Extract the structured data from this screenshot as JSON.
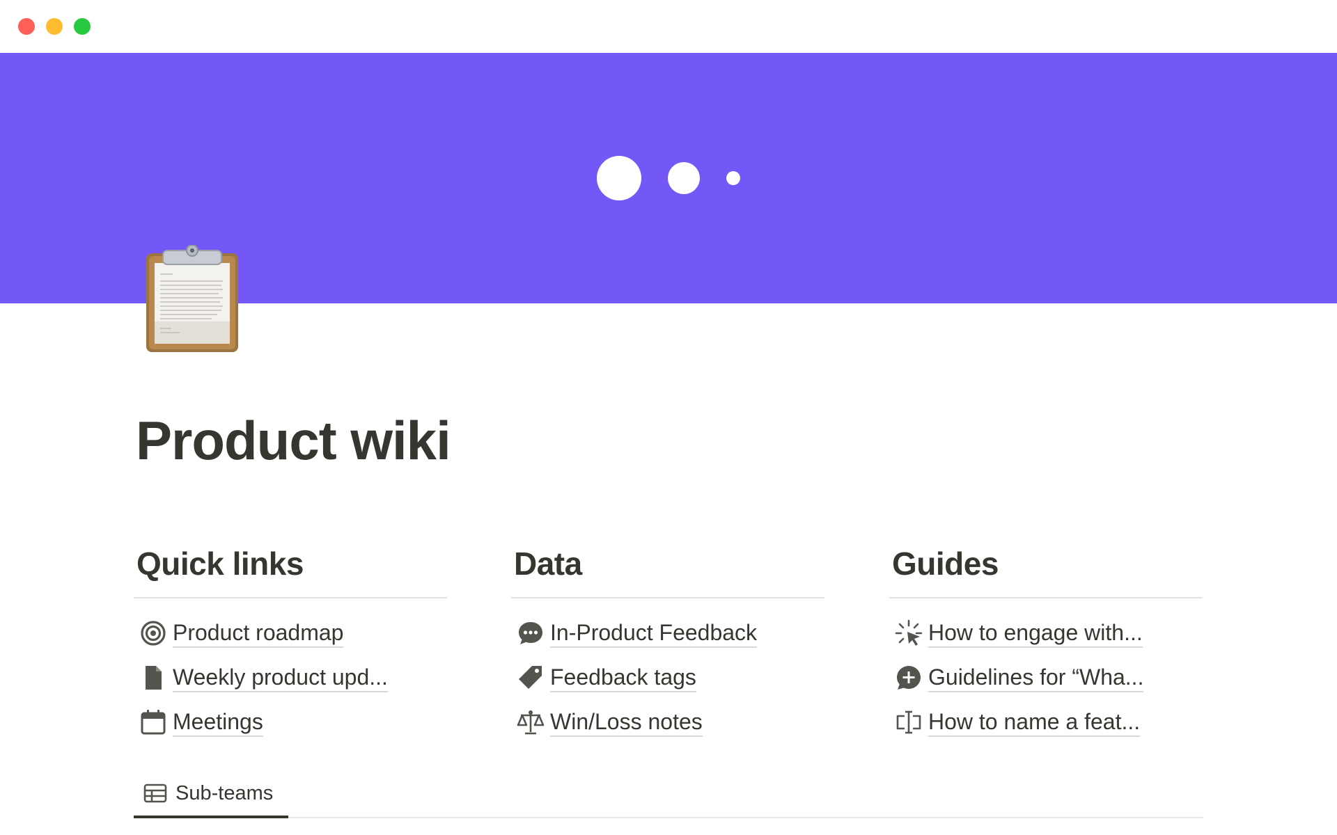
{
  "window": {
    "controls": [
      "close",
      "minimize",
      "maximize"
    ]
  },
  "cover": {
    "color": "#7357f7"
  },
  "page": {
    "title": "Product wiki",
    "icon": "clipboard-icon"
  },
  "columns": [
    {
      "heading": "Quick links",
      "items": [
        {
          "icon": "target-icon",
          "label": "Product roadmap"
        },
        {
          "icon": "document-icon",
          "label": "Weekly product upd..."
        },
        {
          "icon": "calendar-icon",
          "label": "Meetings"
        }
      ]
    },
    {
      "heading": "Data",
      "items": [
        {
          "icon": "chat-bubble-icon",
          "label": "In-Product Feedback"
        },
        {
          "icon": "tag-icon",
          "label": "Feedback tags"
        },
        {
          "icon": "scales-icon",
          "label": "Win/Loss notes"
        }
      ]
    },
    {
      "heading": "Guides",
      "items": [
        {
          "icon": "cursor-click-icon",
          "label": "How to engage with..."
        },
        {
          "icon": "plus-bubble-icon",
          "label": "Guidelines for “Wha..."
        },
        {
          "icon": "text-cursor-icon",
          "label": "How to name a feat..."
        }
      ]
    }
  ],
  "tabs": [
    {
      "icon": "table-icon",
      "label": "Sub-teams",
      "active": true
    }
  ]
}
